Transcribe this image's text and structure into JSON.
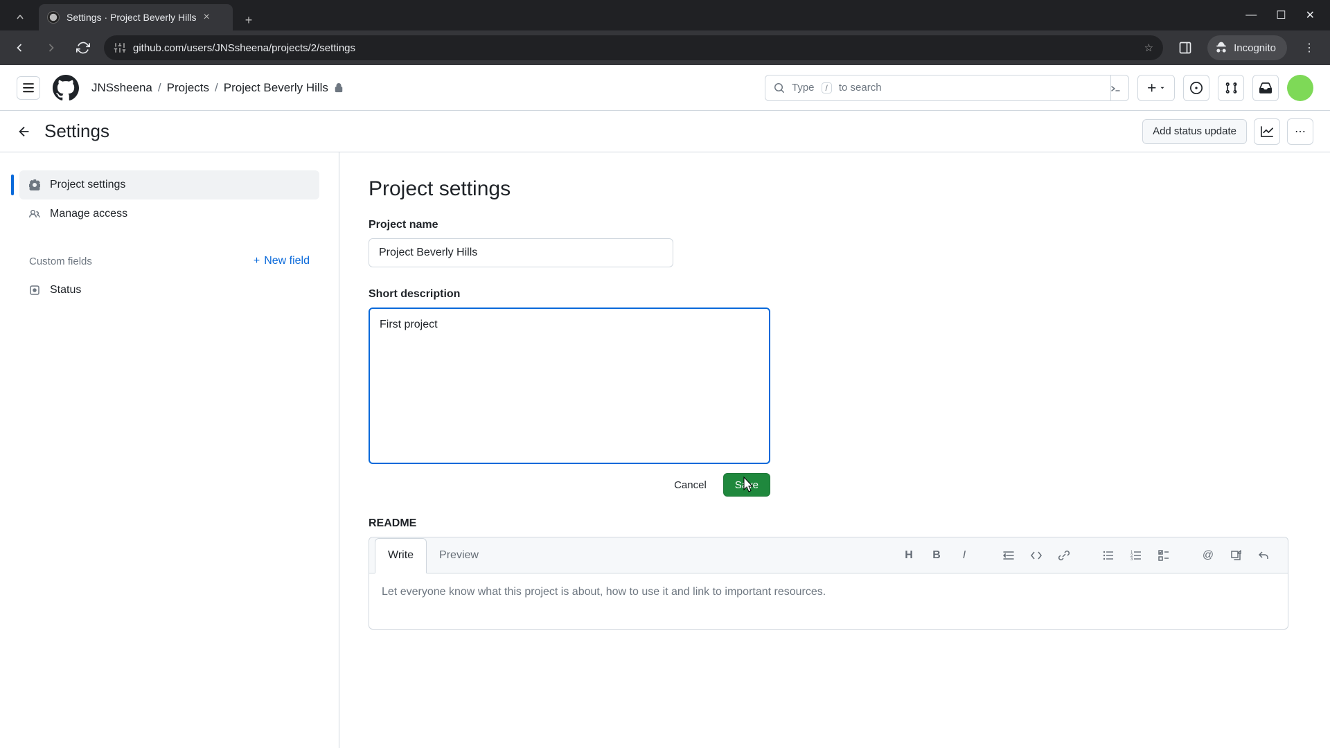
{
  "browser": {
    "tab_title": "Settings · Project Beverly Hills",
    "url": "github.com/users/JNSsheena/projects/2/settings",
    "incognito_label": "Incognito"
  },
  "gh_header": {
    "breadcrumb": {
      "user": "JNSsheena",
      "projects": "Projects",
      "project": "Project Beverly Hills"
    },
    "search_placeholder_pre": "Type",
    "search_key": "/",
    "search_placeholder_post": "to search"
  },
  "subheader": {
    "title": "Settings",
    "add_status": "Add status update"
  },
  "sidebar": {
    "items": [
      {
        "label": "Project settings"
      },
      {
        "label": "Manage access"
      }
    ],
    "custom_fields_heading": "Custom fields",
    "new_field": "New field",
    "status_item": "Status"
  },
  "content": {
    "heading": "Project settings",
    "name_label": "Project name",
    "name_value": "Project Beverly Hills",
    "desc_label": "Short description",
    "desc_value": "First project ",
    "cancel": "Cancel",
    "save": "Save",
    "readme_label": "README",
    "tabs": {
      "write": "Write",
      "preview": "Preview"
    },
    "readme_placeholder": "Let everyone know what this project is about, how to use it and link to important resources."
  }
}
